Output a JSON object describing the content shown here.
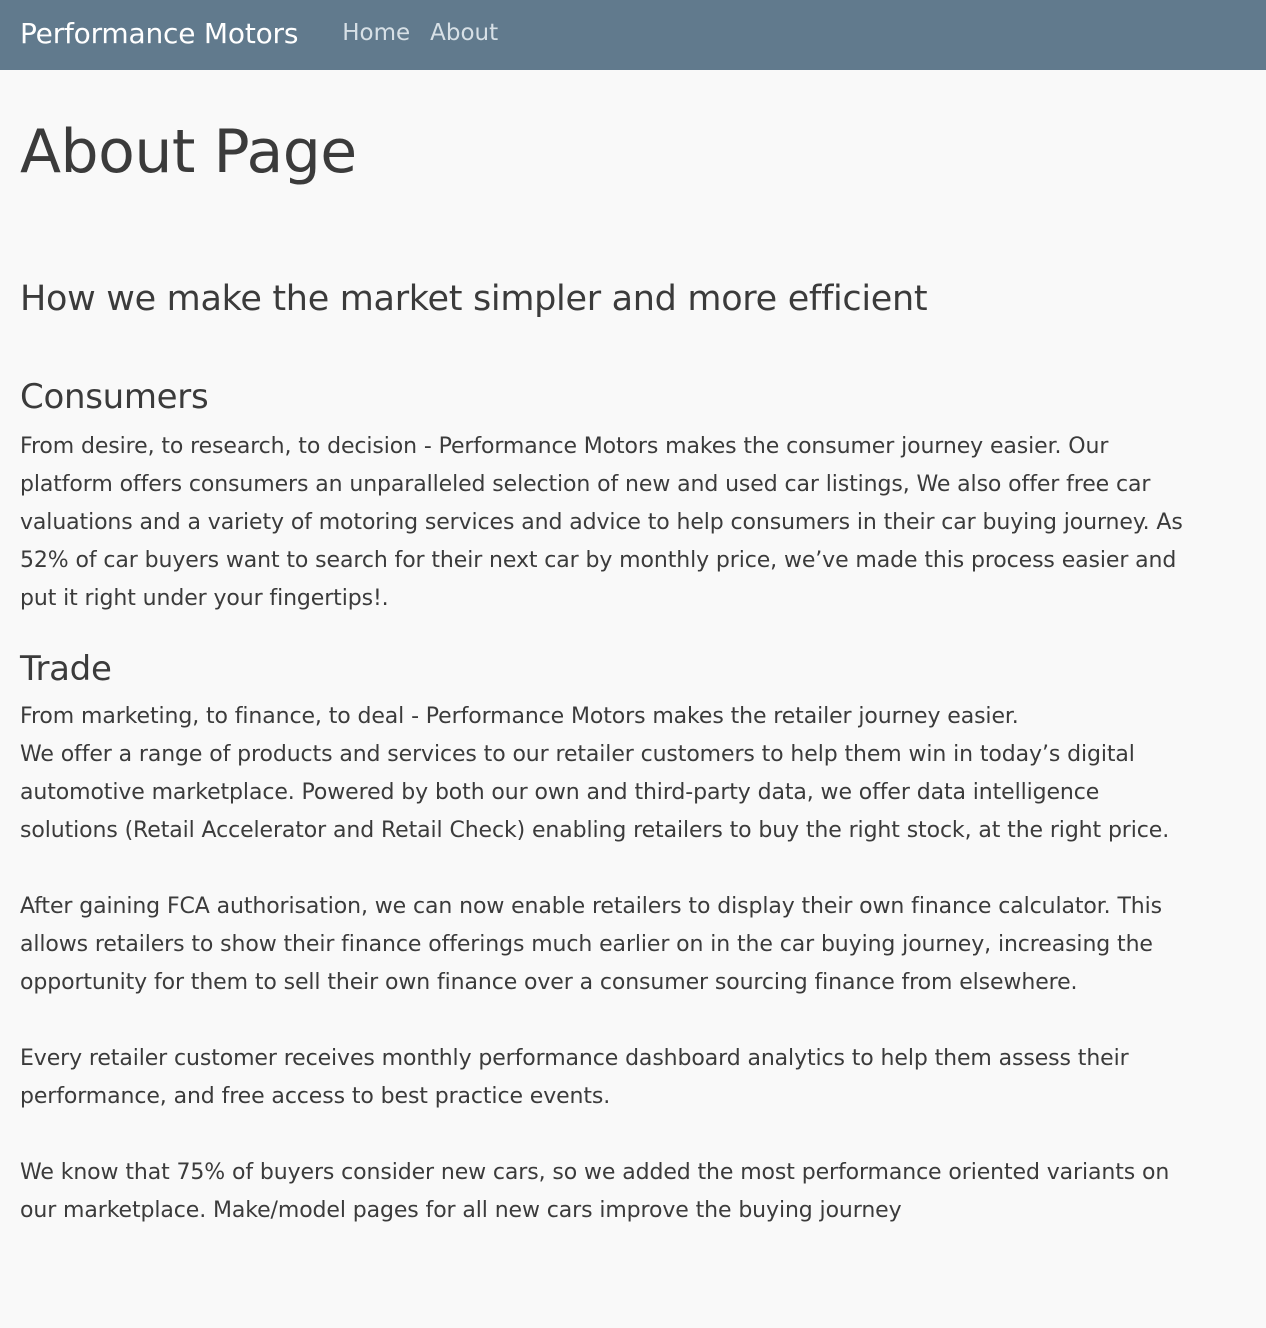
{
  "nav": {
    "brand": "Performance Motors",
    "links": [
      "Home",
      "About"
    ]
  },
  "page": {
    "title": "About Page",
    "subtitle": "How we make the market simpler and more efficient",
    "consumers": {
      "heading": "Consumers",
      "text": "From desire, to research, to decision - Performance Motors makes the consumer journey easier. Our platform offers consumers an unparalleled selection of new and used car listings, We also offer free car valuations and a variety of motoring services and advice to help consumers in their car buying journey. As 52% of car buyers want to search for their next car by monthly price, we’ve made this process easier and put it right under your fingertips!."
    },
    "trade": {
      "heading": "Trade",
      "intro": "From marketing, to finance, to deal - Performance Motors makes the retailer journey easier.",
      "paragraphs": [
        "We offer a range of products and services to our retailer customers to help them win in today’s digital automotive marketplace. Powered by both our own and third-party data, we offer data intelligence solutions (Retail Accelerator and Retail Check) enabling retailers to buy the right stock, at the right price.",
        "After gaining FCA authorisation, we can now enable retailers to display their own finance calculator. This allows retailers to show their finance offerings much earlier on in the car buying journey, increasing the opportunity for them to sell their own finance over a consumer sourcing finance from elsewhere.",
        "Every retailer customer receives monthly performance dashboard analytics to help them assess their performance, and free access to best practice events.",
        "We know that 75% of buyers consider new cars, so we added the most performance oriented variants on our marketplace. Make/model pages for all new cars improve the buying journey"
      ]
    }
  },
  "colors": {
    "navbar": "#617a8d",
    "background": "#f9f9f9",
    "text": "#3b3b3b"
  }
}
